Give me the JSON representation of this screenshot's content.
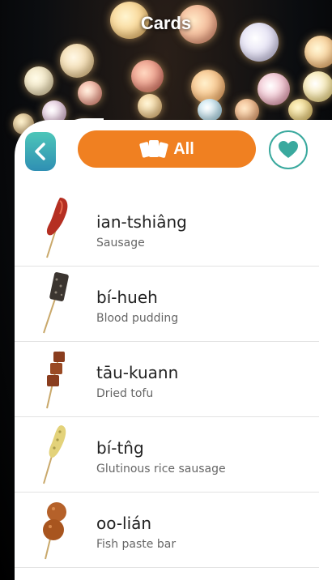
{
  "header": {
    "title": "Cards"
  },
  "filter": {
    "label": "All"
  },
  "cards": [
    {
      "term": "ian-tshiâng",
      "gloss": "Sausage",
      "icon": "sausage-skewer-icon"
    },
    {
      "term": "bí-hueh",
      "gloss": "Blood pudding",
      "icon": "blood-pudding-skewer-icon"
    },
    {
      "term": "tāu-kuann",
      "gloss": "Dried tofu",
      "icon": "tofu-skewer-icon"
    },
    {
      "term": "bí-tn̂g",
      "gloss": "Glutinous rice sausage",
      "icon": "rice-sausage-skewer-icon"
    },
    {
      "term": "oo-lián",
      "gloss": "Fish paste bar",
      "icon": "fish-paste-skewer-icon"
    }
  ],
  "colors": {
    "accent_orange": "#f08021",
    "accent_teal": "#3aa99e",
    "back_gradient_top": "#4dc6b9",
    "back_gradient_bottom": "#2f8fb3"
  }
}
